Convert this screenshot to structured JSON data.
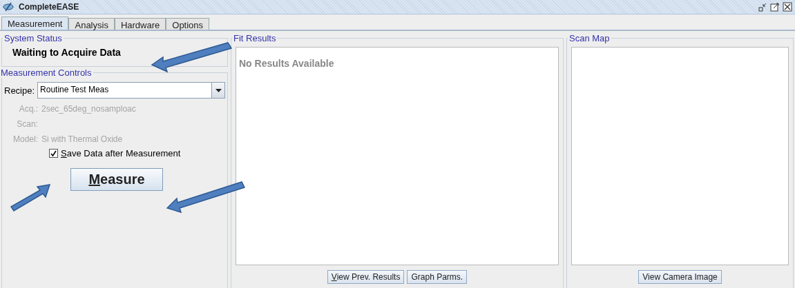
{
  "window": {
    "title": "CompleteEASE"
  },
  "tabs": [
    {
      "label": "Measurement",
      "selected": true
    },
    {
      "label": "Analysis",
      "selected": false
    },
    {
      "label": "Hardware",
      "selected": false
    },
    {
      "label": "Options",
      "selected": false
    }
  ],
  "system_status": {
    "title": "System Status",
    "message": "Waiting to Acquire Data"
  },
  "measurement_controls": {
    "title": "Measurement Controls",
    "recipe": {
      "label": "Recipe:",
      "value": "Routine Test Meas"
    },
    "details": [
      {
        "label": "Acq.:",
        "value": "2sec_65deg_nosamploac",
        "disabled": true
      },
      {
        "label": "Scan:",
        "disabled": true
      },
      {
        "label": "Model:",
        "value": "Si with Thermal Oxide",
        "disabled": true
      }
    ],
    "save_data": {
      "label": "Save Data after Measurement",
      "checked": true
    },
    "measure_button": "Measure"
  },
  "fit_results": {
    "title": "Fit Results",
    "message": "No Results Available",
    "buttons": [
      "View Prev. Results",
      "Graph Parms."
    ]
  },
  "scan_map": {
    "title": "Scan Map",
    "buttons": [
      "View Camera Image"
    ]
  }
}
